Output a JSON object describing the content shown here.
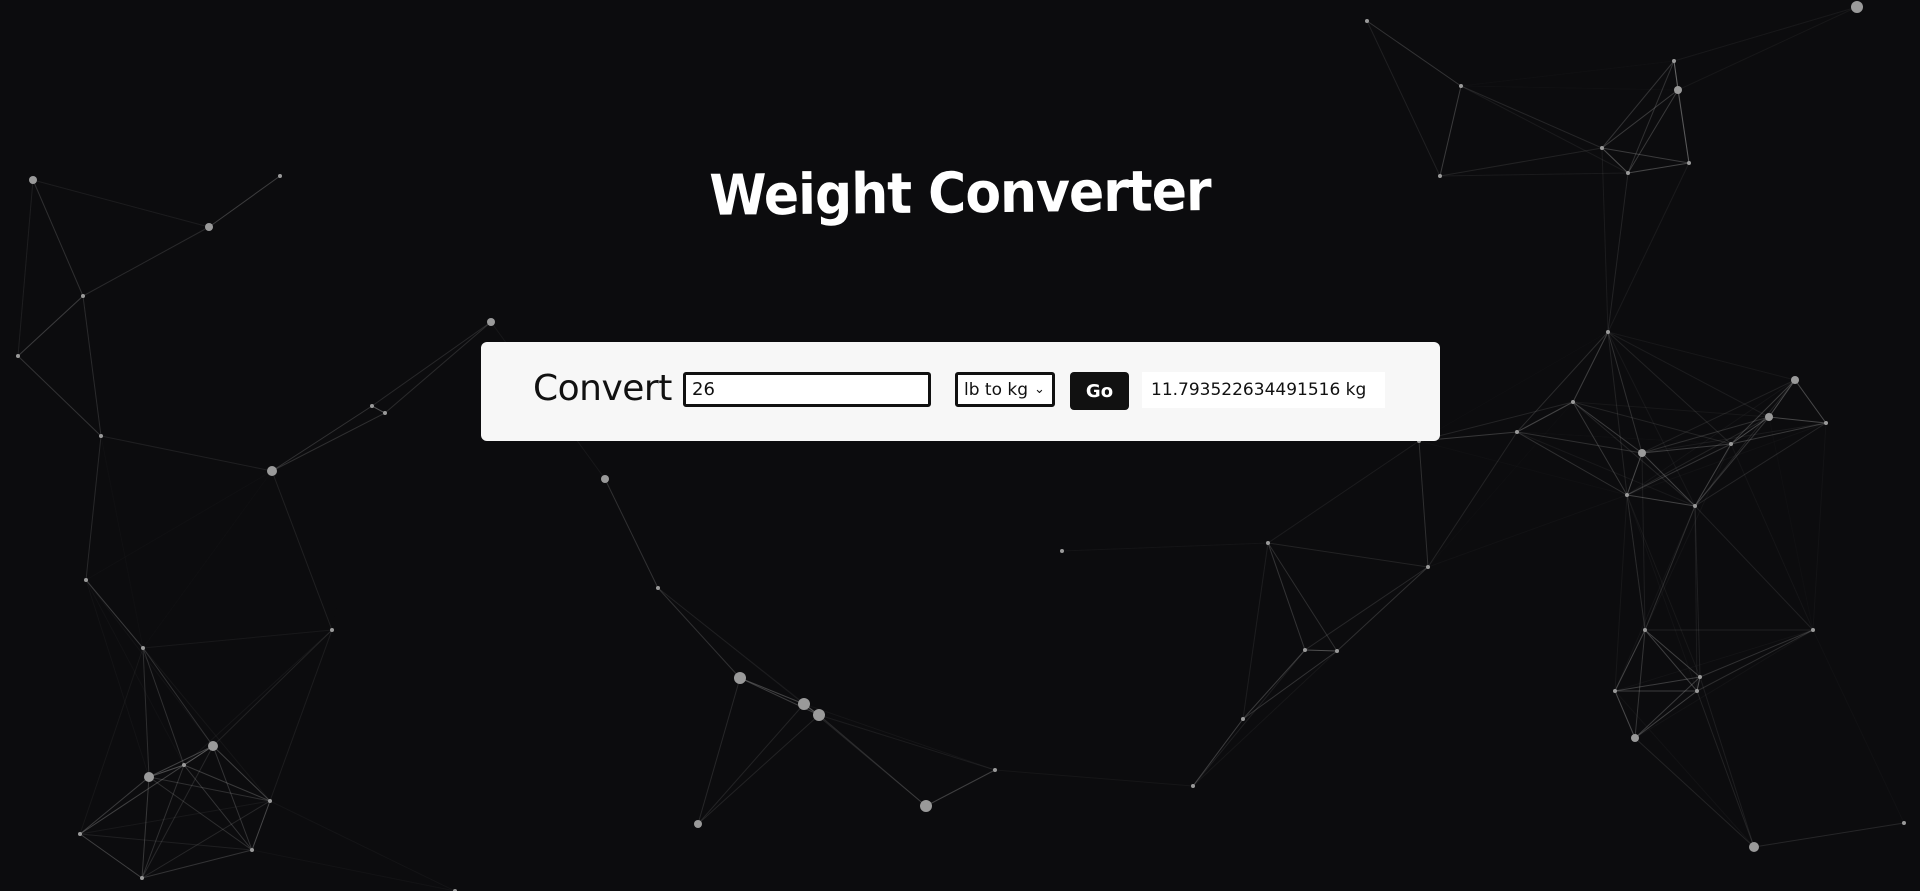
{
  "title": "Weight Converter",
  "form": {
    "label": "Convert",
    "input_value": "26",
    "selected_conversion": "lb to kg",
    "go_label": "Go",
    "result": "11.793522634491516  kg"
  },
  "colors": {
    "background": "#0c0c0e",
    "card": "#f7f7f7",
    "button": "#111111",
    "text": "#111111",
    "title": "#ffffff",
    "network": "#9a9a9a"
  },
  "icons": {
    "select": "chevron-down-icon"
  }
}
